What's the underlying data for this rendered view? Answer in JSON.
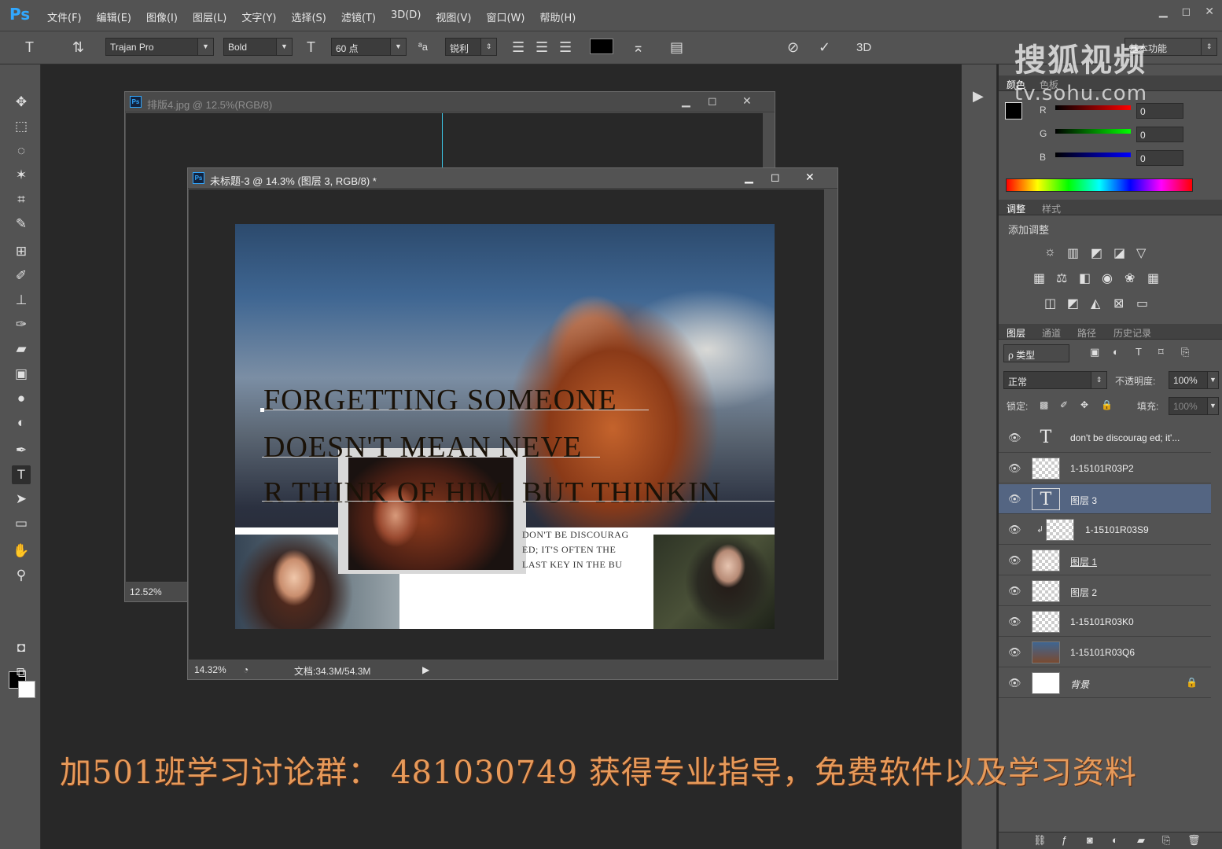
{
  "app": {
    "logo": "Ps"
  },
  "menu": [
    "文件(F)",
    "编辑(E)",
    "图像(I)",
    "图层(L)",
    "文字(Y)",
    "选择(S)",
    "滤镜(T)",
    "3D(D)",
    "视图(V)",
    "窗口(W)",
    "帮助(H)"
  ],
  "options": {
    "font_family": "Trajan Pro",
    "font_style": "Bold",
    "font_size": "60 点",
    "aa_label": "ªa",
    "antialias": "锐利",
    "mode_3d": "3D",
    "text_color": "#000000"
  },
  "doc_back": {
    "title": "排版4.jpg @ 12.5%(RGB/8)",
    "zoom": "12.52%"
  },
  "doc_front": {
    "title": "未标题-3 @ 14.3% (图层 3, RGB/8) *",
    "zoom": "14.32%",
    "doc_info": "文档:34.3M/54.3M",
    "headline_1": "FORGETTING SOMEONE",
    "headline_2": "DOESN'T MEAN NEVE",
    "headline_3": "R THINK OF HIM, BUT THINKIN",
    "small_1": "DON'T BE DISCOURAG",
    "small_2": "ED; IT'S OFTEN THE",
    "small_3": "LAST KEY IN THE BU"
  },
  "color_panel": {
    "tabs": [
      "颜色",
      "色板"
    ],
    "r_label": "R",
    "g_label": "G",
    "b_label": "B",
    "r": "0",
    "g": "0",
    "b": "0"
  },
  "adjust_panel": {
    "tabs": [
      "调整",
      "样式"
    ],
    "heading": "添加调整"
  },
  "layers_panel": {
    "tabs": [
      "图层",
      "通道",
      "路径",
      "历史记录"
    ],
    "filter_kind": "ρ 类型",
    "blend_mode": "正常",
    "opacity_label": "不透明度:",
    "opacity": "100%",
    "lock_label": "锁定:",
    "fill_label": "填充:",
    "fill": "100%",
    "layers": [
      {
        "name": "don't be discourag ed; it'...",
        "type": "text"
      },
      {
        "name": "1-15101R03P2",
        "type": "image"
      },
      {
        "name": "图层 3",
        "type": "text",
        "selected": true
      },
      {
        "name": "1-15101R03S9",
        "type": "image"
      },
      {
        "name": "图层 1",
        "type": "image"
      },
      {
        "name": "图层 2",
        "type": "image"
      },
      {
        "name": "1-15101R03K0",
        "type": "image"
      },
      {
        "name": "1-15101R03Q6",
        "type": "image"
      },
      {
        "name": "背景",
        "type": "image"
      }
    ]
  },
  "watermark": {
    "name": "搜狐视频",
    "url": "tv.sohu.com",
    "top_right_label": "基本功能"
  },
  "promo": "加501班学习讨论群：  481030749  获得专业指导，免费软件以及学习资料",
  "colors": {
    "accent": "#31a8ff",
    "selected_layer": "#546582",
    "promo_text": "#e79a5a"
  }
}
